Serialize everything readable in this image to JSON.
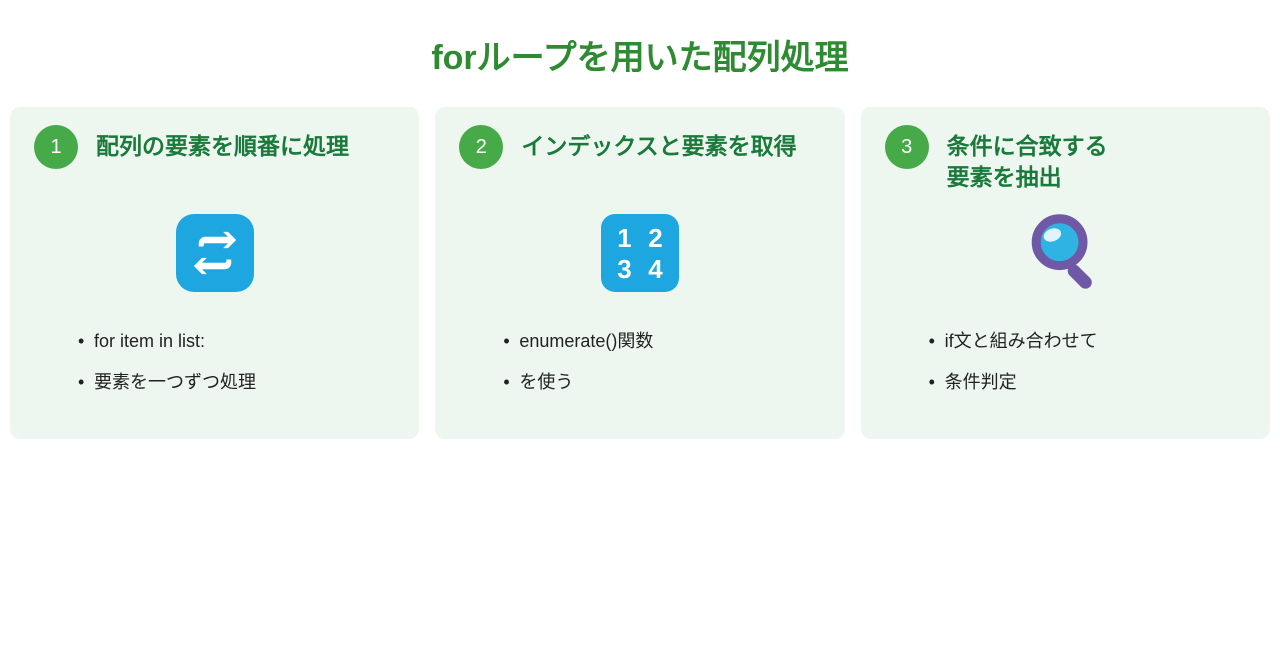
{
  "title": "forループを用いた配列処理",
  "cards": [
    {
      "num": "1",
      "title": "配列の要素を順番に処理",
      "icon": "loop",
      "bullets": [
        "for item in list:",
        "要素を一つずつ処理"
      ]
    },
    {
      "num": "2",
      "title": "インデックスと要素を取得",
      "icon": "numbers",
      "bullets": [
        "enumerate()関数",
        "を使う"
      ]
    },
    {
      "num": "3",
      "title": "条件に合致する\n要素を抽出",
      "icon": "magnify",
      "bullets": [
        "if文と組み合わせて",
        "条件判定"
      ]
    }
  ],
  "colors": {
    "title_green": "#2e8b32",
    "card_bg": "#eef7ef",
    "badge_green": "#46aa49",
    "card_title_green": "#1a7a3c",
    "icon_blue": "#1ea6e0",
    "magnify_purple": "#6f58a6",
    "magnify_lens": "#2fb3e3"
  }
}
